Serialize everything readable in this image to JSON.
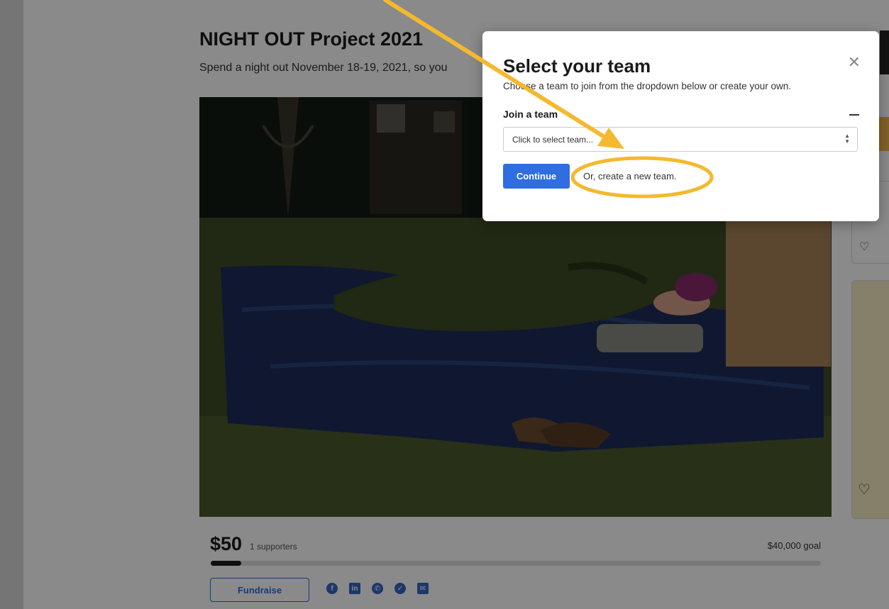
{
  "campaign": {
    "title": "NIGHT OUT Project 2021",
    "subtitle": "Spend a night out November 18-19, 2021, so you",
    "raised": "$50",
    "supporters": "1 supporters",
    "goal": "$40,000 goal",
    "progress_percent": 5,
    "fundraise_label": "Fundraise",
    "share_icons": [
      {
        "name": "facebook-icon",
        "glyph": "f"
      },
      {
        "name": "linkedin-icon",
        "glyph": "in"
      },
      {
        "name": "whatsapp-icon",
        "glyph": "✆"
      },
      {
        "name": "twitter-icon",
        "glyph": "✓"
      },
      {
        "name": "email-icon",
        "glyph": "✉"
      }
    ]
  },
  "modal": {
    "title": "Select your team",
    "description": "Choose a team to join from the dropdown below or create your own.",
    "close_glyph": "✕",
    "join_label": "Join a team",
    "select_placeholder": "Click to select team...",
    "continue_label": "Continue",
    "create_link": "Or, create a new team."
  },
  "colors": {
    "accent": "#2f6de0",
    "annotation": "#f5b82e"
  }
}
